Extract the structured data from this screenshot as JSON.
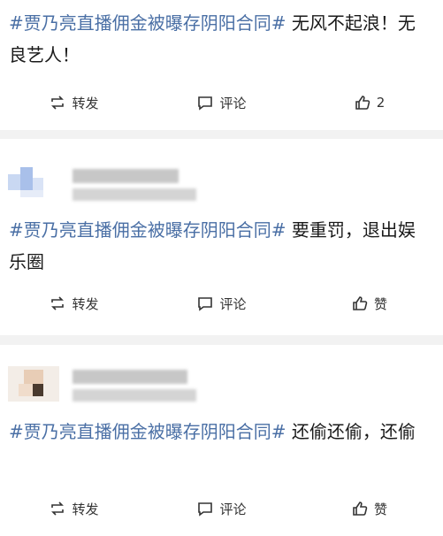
{
  "posts": [
    {
      "topic": "#贾乃亮直播佣金被曝存阴阳合同#",
      "body": " 无风不起浪！无良艺人！",
      "actions": {
        "repost": "转发",
        "comment": "评论",
        "like": "2"
      }
    },
    {
      "topic": "#贾乃亮直播佣金被曝存阴阳合同#",
      "body": " 要重罚，退出娱乐圈",
      "actions": {
        "repost": "转发",
        "comment": "评论",
        "like": "赞"
      }
    },
    {
      "topic": "#贾乃亮直播佣金被曝存阴阳合同#",
      "body": " 还偷还偷，还偷",
      "actions": {
        "repost": "转发",
        "comment": "评论",
        "like": "赞"
      }
    }
  ]
}
